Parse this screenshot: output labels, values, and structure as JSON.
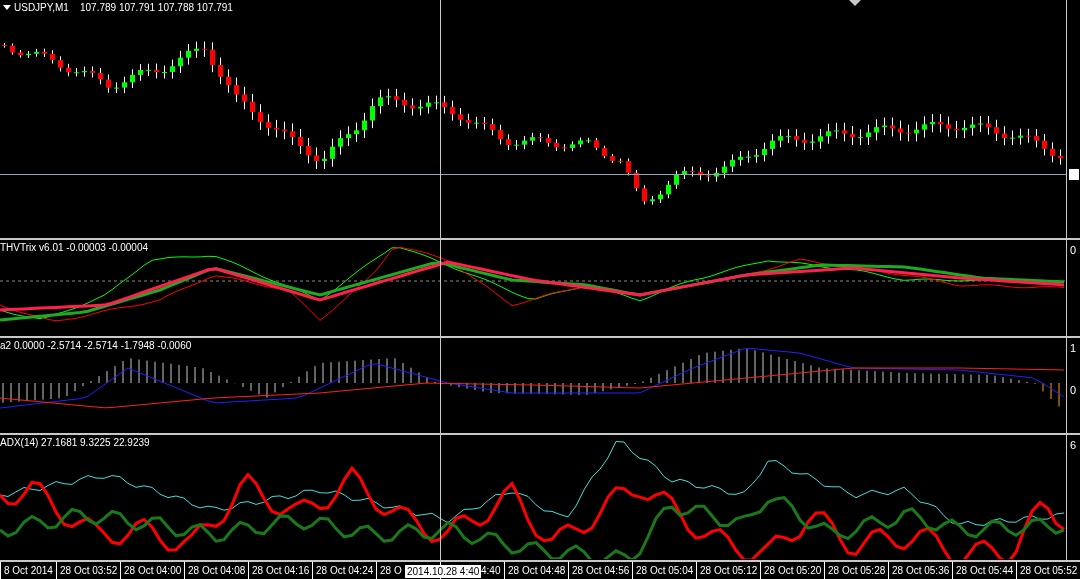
{
  "chart": {
    "symbol": "USDJPY,M1",
    "ohlc": "107.789 107.791 107.788 107.791"
  },
  "indicators": [
    {
      "kind": "trix",
      "label": "THVTrix v6.01 -0.00003 -0.00004",
      "axis_labels": [
        "0"
      ]
    },
    {
      "kind": "histogram",
      "label": "a2 0.0000 -2.5714 -2.5714 -1.7948 -0.0060",
      "axis_labels": [
        "1",
        "0"
      ]
    },
    {
      "kind": "adx",
      "label": "ADX(14) 27.1681 9.3225 22.9239",
      "axis_labels": [
        "6"
      ]
    }
  ],
  "time_axis": {
    "labels": [
      "8 Oct 2014",
      "28 Oct 03:52",
      "28 Oct 04:00",
      "28 Oct 04:08",
      "28 Oct 04:16",
      "28 Oct 04:24",
      "28 O",
      "4:40",
      "28 Oct 04:48",
      "28 Oct 04:56",
      "28 Oct 05:04",
      "28 Oct 05:12",
      "28 Oct 05:20",
      "28 Oct 05:28",
      "28 Oct 05:36",
      "28 Oct 05:44",
      "28 Oct 05:52"
    ],
    "crosshair_label": "2014.10.28 4:40"
  }
}
